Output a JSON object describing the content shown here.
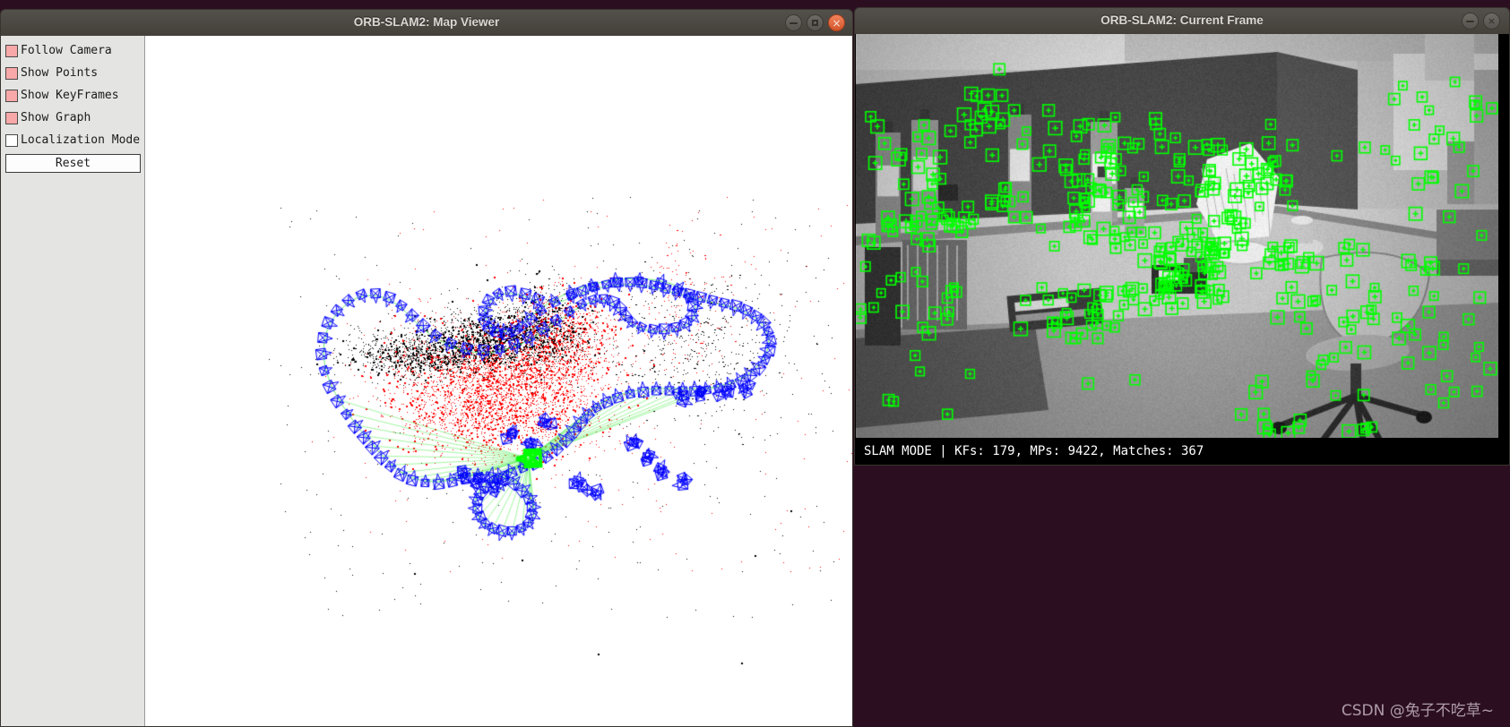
{
  "desktop": {
    "background_color": "#2c0e21",
    "watermark": "CSDN @兔子不吃草~"
  },
  "map_window": {
    "title": "ORB-SLAM2: Map Viewer",
    "window_buttons": [
      {
        "name": "minimize",
        "glyph": "–"
      },
      {
        "name": "maximize",
        "glyph": "□"
      },
      {
        "name": "close",
        "glyph": "×"
      }
    ],
    "controls": {
      "checkboxes": [
        {
          "label": "Follow Camera",
          "checked": true
        },
        {
          "label": "Show Points",
          "checked": true
        },
        {
          "label": "Show KeyFrames",
          "checked": true
        },
        {
          "label": "Show Graph",
          "checked": true
        },
        {
          "label": "Localization Mode",
          "checked": false
        }
      ],
      "reset_label": "Reset",
      "checked_color": "#f8a8a8",
      "unchecked_color": "#ffffff"
    },
    "viewer": {
      "background_color": "#ffffff",
      "keyframe_color": "#0000ff",
      "graph_edge_color": "#55ee55",
      "current_camera_color": "#00ff00",
      "map_point_color": "#000000",
      "local_map_point_color": "#ff0000"
    }
  },
  "frame_window": {
    "title": "ORB-SLAM2: Current Frame",
    "window_buttons": [
      {
        "name": "minimize",
        "glyph": "–"
      },
      {
        "name": "close",
        "glyph": "×"
      }
    ],
    "status": {
      "text": "SLAM MODE |  KFs: 179, MPs: 9422, Matches: 367",
      "mode": "SLAM MODE",
      "keyframes": 179,
      "map_points": 9422,
      "matches": 367,
      "text_color": "#ffffff",
      "background_color": "#000000"
    },
    "features": {
      "marker_color": "#00ff00",
      "marker_shape": "square-with-cross"
    }
  }
}
